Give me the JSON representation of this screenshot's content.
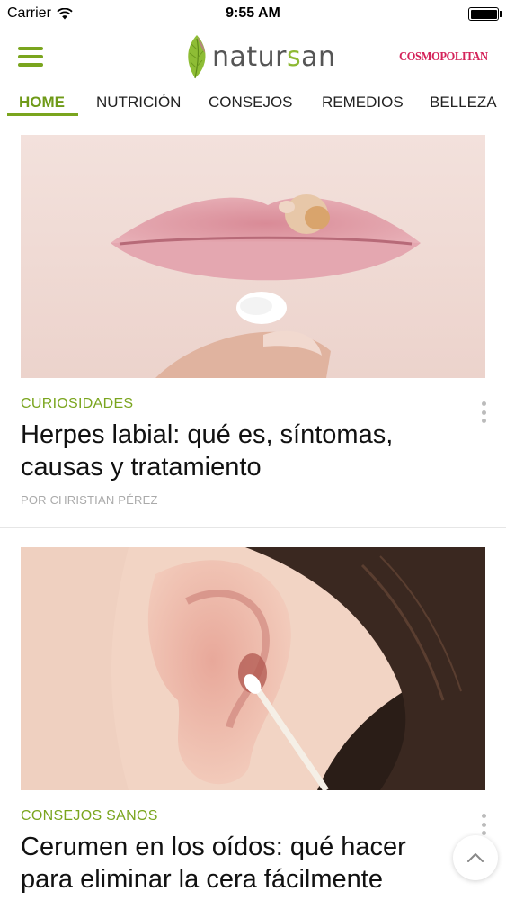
{
  "status_bar": {
    "carrier": "Carrier",
    "time": "9:55 AM"
  },
  "header": {
    "logo_prefix": "natur",
    "logo_accent": "s",
    "logo_suffix": "an",
    "partner": "COSMOPOLITAN",
    "brand_color": "#7aa51e",
    "partner_color": "#d4235a"
  },
  "tabs": [
    {
      "label": "HOME",
      "active": true
    },
    {
      "label": "NUTRICIÓN",
      "active": false
    },
    {
      "label": "CONSEJOS",
      "active": false
    },
    {
      "label": "REMEDIOS",
      "active": false
    },
    {
      "label": "BELLEZA",
      "active": false
    }
  ],
  "articles": [
    {
      "category": "CURIOSIDADES",
      "title": "Herpes labial: qué es, síntomas, causas y tratamiento",
      "author": "POR CHRISTIAN PÉREZ",
      "image": "lips-with-cold-sore-photo"
    },
    {
      "category": "CONSEJOS SANOS",
      "title": "Cerumen en los oídos: qué hacer para eliminar la cera fácilmente",
      "author": "",
      "image": "ear-with-cotton-swab-photo"
    }
  ],
  "icons": {
    "menu": "hamburger-icon",
    "more": "vertical-ellipsis-icon",
    "scroll_top": "chevron-up-icon",
    "wifi": "wifi-icon",
    "battery": "battery-icon"
  }
}
